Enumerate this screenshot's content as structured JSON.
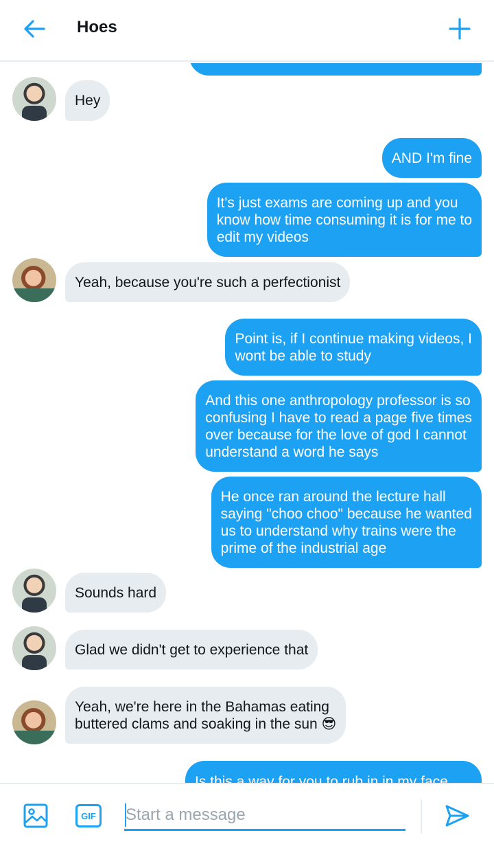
{
  "header": {
    "title": "Hoes"
  },
  "messages": [
    {
      "line1": "Hey"
    },
    {
      "line1": "AND I'm fine"
    },
    {
      "line1": "It's just exams are coming up and you",
      "line2": "know how time consuming it is for me to",
      "line3": "edit my videos"
    },
    {
      "line1": "Yeah, because you're such a perfectionist"
    },
    {
      "line1": "Point is, if I continue making videos, I",
      "line2": "wont be able to study"
    },
    {
      "line1": "And this one anthropology professor is so",
      "line2": "confusing I have to read a page five times",
      "line3": "over because for the love of god I cannot",
      "line4": "understand a word he says"
    },
    {
      "line1": "He once ran around the lecture hall",
      "line2": "saying \"choo choo\" because he wanted",
      "line3": "us to understand why trains were the",
      "line4": "prime of the industrial age"
    },
    {
      "line1": "Sounds hard"
    },
    {
      "line1": "Glad we didn't get to experience that"
    },
    {
      "line1": "Yeah, we're here in the Bahamas eating",
      "line2": "buttered clams and soaking in the sun 😎"
    },
    {
      "line1": "Is this a way for you to rub in in my face"
    }
  ],
  "composer": {
    "placeholder": "Start a message",
    "gif_label": "GIF"
  },
  "icons": {
    "back": "arrow-left-icon",
    "add": "plus-icon",
    "image": "image-icon",
    "gif": "gif-icon",
    "send": "send-icon"
  },
  "colors": {
    "accent": "#1da1f2",
    "incoming_bubble": "#e6ecf0",
    "text": "#14171a"
  }
}
